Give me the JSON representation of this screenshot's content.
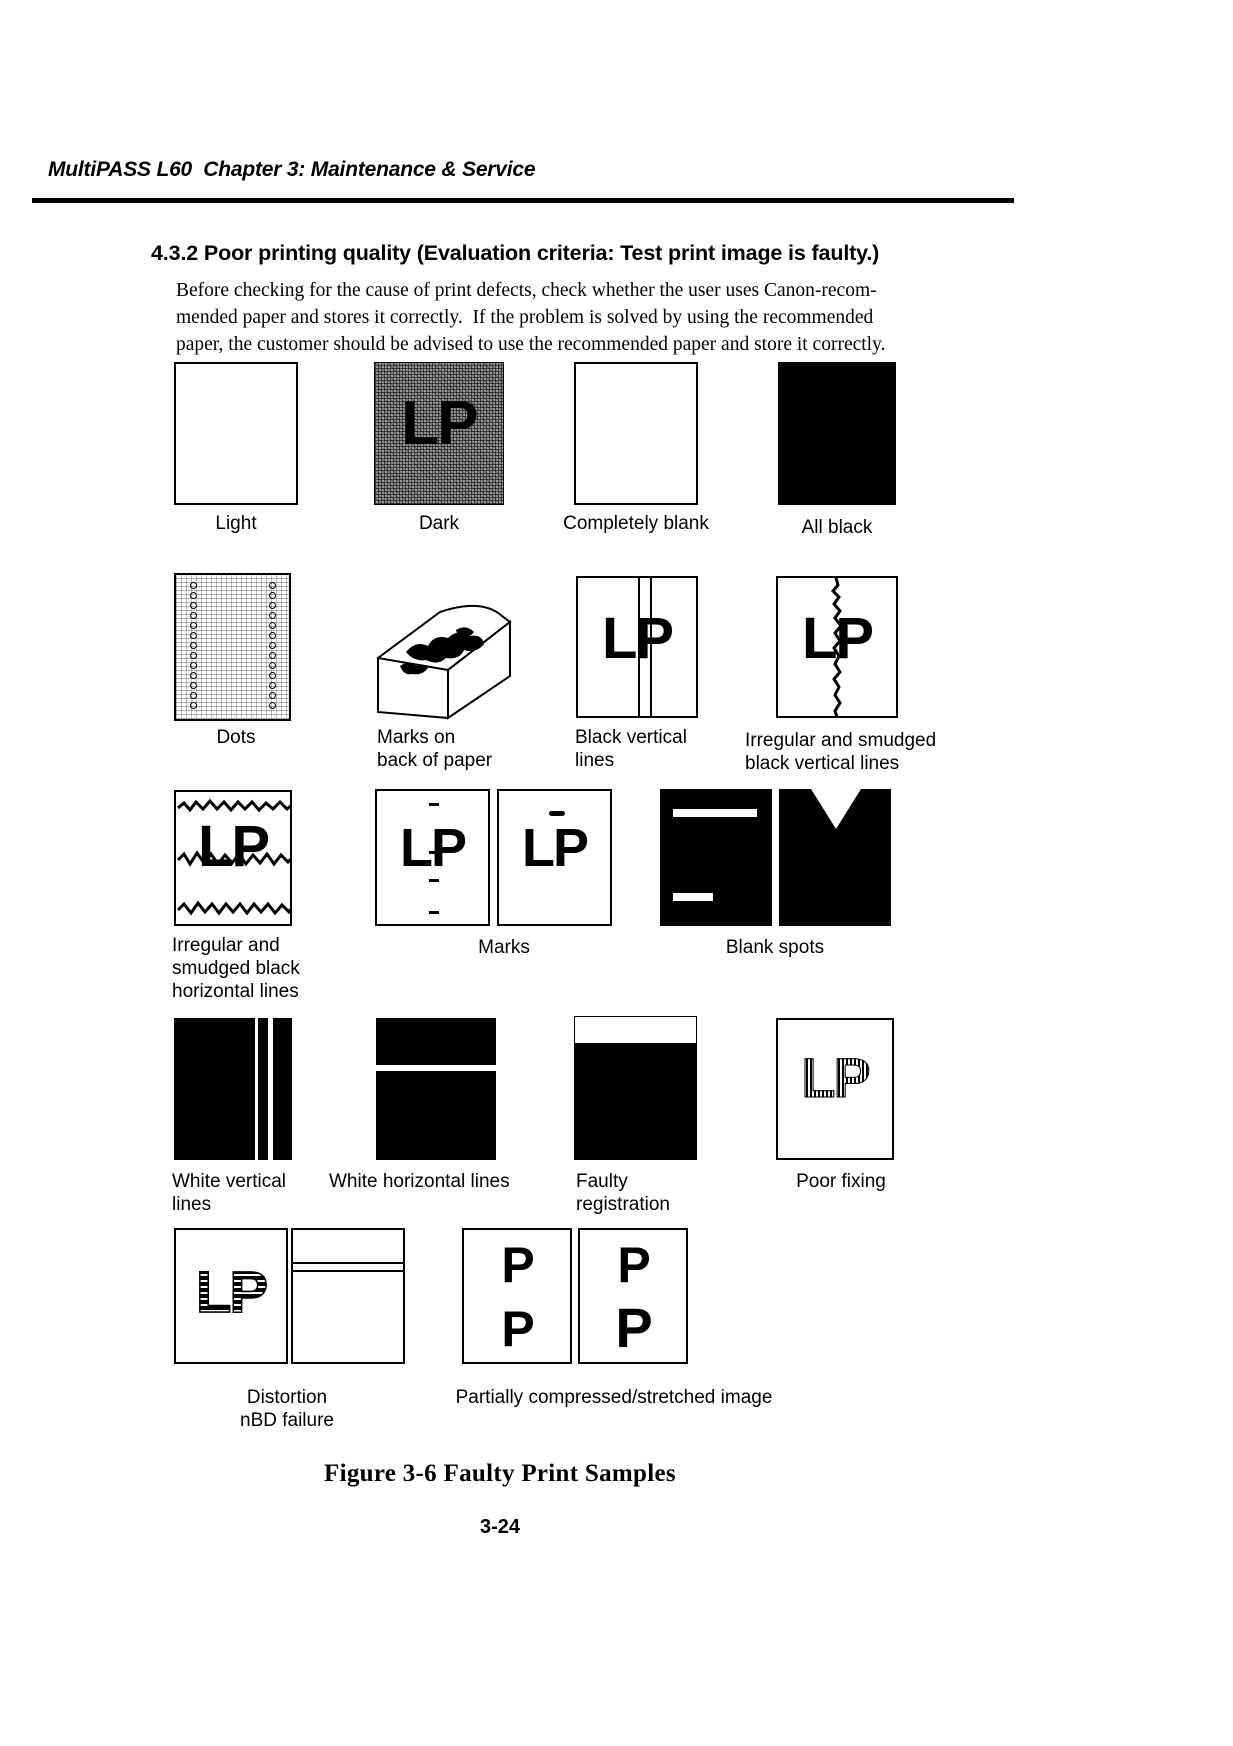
{
  "page": {
    "running_header": "MultiPASS L60  Chapter 3: Maintenance & Service",
    "folio": "3-24"
  },
  "section": {
    "number_and_title": "4.3.2 Poor printing quality (Evaluation criteria: Test print image is faulty.)",
    "body_lines": [
      "Before checking for the cause of print defects, check whether the user uses Canon-recom-",
      "mended paper and stores it correctly.  If the problem is solved by using the recommended",
      "paper, the customer should be advised to use the recommended paper and store it correctly."
    ]
  },
  "figure": {
    "caption": "Figure 3-6 Faulty Print Samples",
    "sample_text": "LP",
    "compressed_text": "P",
    "rows": [
      {
        "name": "row-1",
        "labels": [
          "Light",
          "Dark",
          "Completely blank",
          "All black"
        ]
      },
      {
        "name": "row-2",
        "labels": [
          "Dots",
          "Marks on\nback of paper",
          "Black vertical\nlines",
          "Irregular and smudged\nblack vertical lines"
        ]
      },
      {
        "name": "row-3",
        "labels": [
          "Irregular and\nsmudged black\nhorizontal lines",
          "Marks",
          "Blank spots"
        ]
      },
      {
        "name": "row-4",
        "labels": [
          "White vertical\nlines",
          "White horizontal lines",
          "Faulty\nregistration",
          "Poor fixing"
        ]
      },
      {
        "name": "row-5",
        "labels": [
          "Distortion\nnBD failure",
          "Partially compressed/stretched image"
        ]
      }
    ]
  },
  "colors": {
    "ink": "#000000",
    "paper": "#ffffff",
    "halftone_gray": "#9a9a9a"
  }
}
